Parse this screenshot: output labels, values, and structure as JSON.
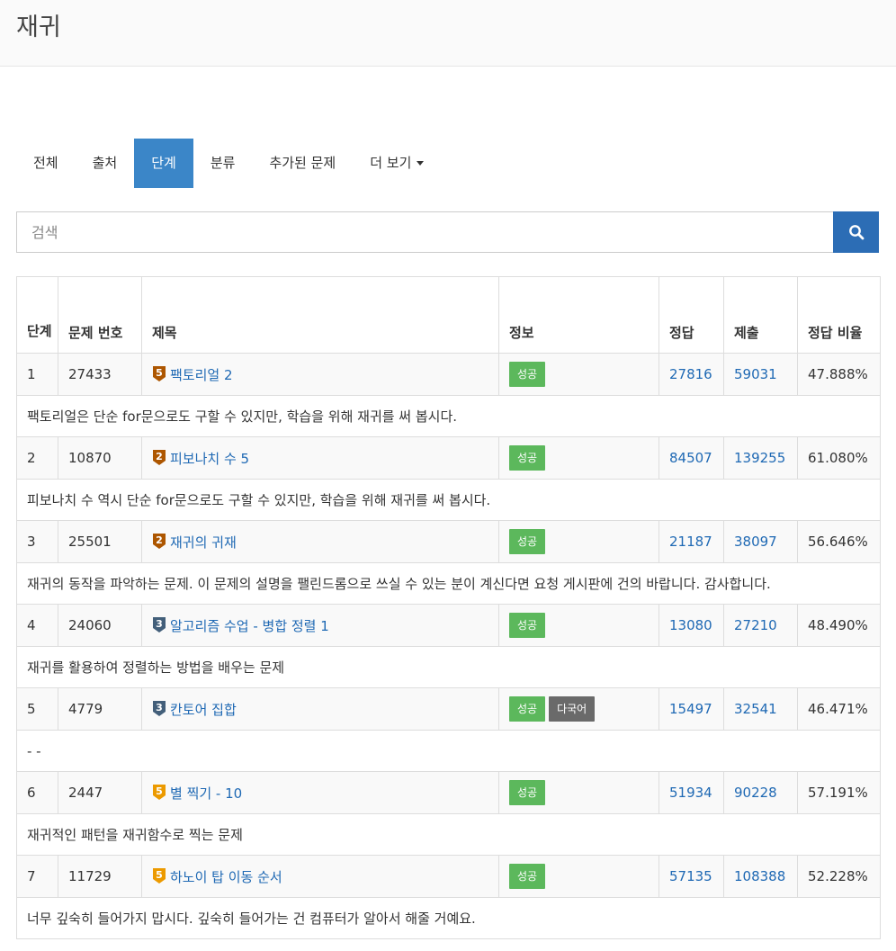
{
  "page": {
    "title": "재귀"
  },
  "tabs": [
    {
      "label": "전체",
      "active": false
    },
    {
      "label": "출처",
      "active": false
    },
    {
      "label": "단계",
      "active": true
    },
    {
      "label": "분류",
      "active": false
    },
    {
      "label": "추가된 문제",
      "active": false
    },
    {
      "label": "더 보기",
      "active": false
    }
  ],
  "search": {
    "placeholder": "검색",
    "icon": "search-icon"
  },
  "colors": {
    "active_tab": "#3b86c8",
    "search_button": "#2c6db5",
    "link": "#1f69b4",
    "success": "#5cb85c",
    "gray_label": "#6a6a6a",
    "bronze": "#ad5600",
    "silver": "#435f7a",
    "gold": "#ec9a00"
  },
  "table": {
    "headers": {
      "step": "단계",
      "id": "문제 번호",
      "title": "제목",
      "info": "정보",
      "correct": "정답",
      "submit": "제출",
      "ratio": "정답 비율"
    },
    "rows": [
      {
        "step": "1",
        "id": "27433",
        "tier": "bronze",
        "tier_num": "5",
        "title": "팩토리얼 2",
        "labels": [
          "성공"
        ],
        "correct": "27816",
        "submit": "59031",
        "ratio": "47.888%",
        "desc": "팩토리얼은 단순 for문으로도 구할 수 있지만, 학습을 위해 재귀를 써 봅시다."
      },
      {
        "step": "2",
        "id": "10870",
        "tier": "bronze",
        "tier_num": "2",
        "title": "피보나치 수 5",
        "labels": [
          "성공"
        ],
        "correct": "84507",
        "submit": "139255",
        "ratio": "61.080%",
        "desc": "피보나치 수 역시 단순 for문으로도 구할 수 있지만, 학습을 위해 재귀를 써 봅시다."
      },
      {
        "step": "3",
        "id": "25501",
        "tier": "bronze",
        "tier_num": "2",
        "title": "재귀의 귀재",
        "labels": [
          "성공"
        ],
        "correct": "21187",
        "submit": "38097",
        "ratio": "56.646%",
        "desc": "재귀의 동작을 파악하는 문제. 이 문제의 설명을 팰린드롬으로 쓰실 수 있는 분이 계신다면 요청 게시판에 건의 바랍니다. 감사합니다."
      },
      {
        "step": "4",
        "id": "24060",
        "tier": "silver",
        "tier_num": "3",
        "title": "알고리즘 수업 - 병합 정렬 1",
        "labels": [
          "성공"
        ],
        "correct": "13080",
        "submit": "27210",
        "ratio": "48.490%",
        "desc": "재귀를 활용하여 정렬하는 방법을 배우는 문제"
      },
      {
        "step": "5",
        "id": "4779",
        "tier": "silver",
        "tier_num": "3",
        "title": "칸토어 집합",
        "labels": [
          "성공",
          "다국어"
        ],
        "correct": "15497",
        "submit": "32541",
        "ratio": "46.471%",
        "desc": "- -"
      },
      {
        "step": "6",
        "id": "2447",
        "tier": "gold",
        "tier_num": "5",
        "title": "별 찍기 - 10",
        "labels": [
          "성공"
        ],
        "correct": "51934",
        "submit": "90228",
        "ratio": "57.191%",
        "desc": "재귀적인 패턴을 재귀함수로 찍는 문제"
      },
      {
        "step": "7",
        "id": "11729",
        "tier": "gold",
        "tier_num": "5",
        "title": "하노이 탑 이동 순서",
        "labels": [
          "성공"
        ],
        "correct": "57135",
        "submit": "108388",
        "ratio": "52.228%",
        "desc": "너무 깊숙히 들어가지 맙시다. 깊숙히 들어가는 건 컴퓨터가 알아서 해줄 거예요."
      }
    ]
  }
}
